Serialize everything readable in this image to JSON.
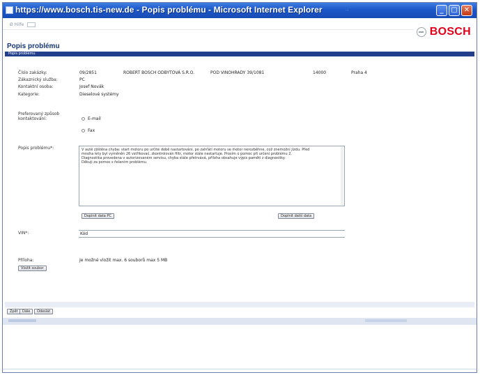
{
  "window": {
    "title": "https://www.bosch.tis-new.de - Popis problému - Microsoft Internet Explorer",
    "faint_text": "...",
    "buttons": {
      "minimize": "_",
      "maximize": "▢",
      "close": "✕"
    }
  },
  "toolbar": {
    "nav_text": "Ø Hilfe"
  },
  "brand": {
    "name": "BOSCH",
    "color": "#e2001a"
  },
  "page": {
    "title": "Popis problému",
    "section": "Popis problému"
  },
  "form": {
    "labels": {
      "case_no": "Číslo zakázky:",
      "service_partner": "Zákaznický služba:",
      "contact": "Kontaktní osoba:",
      "category": "Kategorie:",
      "preferred_contact": "Preferovaný způsob kontaktování:",
      "description": "Popis problému*:",
      "vin": "VIN*:",
      "attachment": "Příloha:"
    },
    "values": {
      "case_no": "09/2851",
      "company": "ROBERT BOSCH ODBYTOVÁ S.R.O.",
      "street": "POD VINOHRADY 39/1081",
      "postcode": "14000",
      "city": "Praha 4",
      "service_partner": "PC",
      "contact": "Josef Novák",
      "category": "Dieselové systémy",
      "vin": "Kód"
    },
    "contact_options": [
      "E-mail",
      "Fax"
    ],
    "description_lines": [
      "V autě zjištěna chyba: start motoru po určité době nastartování, po zahřátí motoru se motor nerozběhne, což znemožní jízdu. Před",
      "mnoha lety byl vyměněn 26 vstřikovač, zkontrolován filtr, motor stále nestartuje. Prosím o pomoc při určení problému 2.",
      "Diagnostika provedena v autorizovaném servisu, chyba stále přetrvává, příloha obsahuje výpis paměti z diagnostiky.",
      "Děkuji za pomoc s řešením problému."
    ],
    "attachment_text": "Je možné vložit max. 6 souborů max 5 MB",
    "buttons": {
      "add_pc": "Doplnit data PC",
      "add_context": "Doplnit další data",
      "add_file": "Vložit soubor",
      "back": "Zpět",
      "next": "Dále",
      "submit": "Odeslat"
    }
  }
}
